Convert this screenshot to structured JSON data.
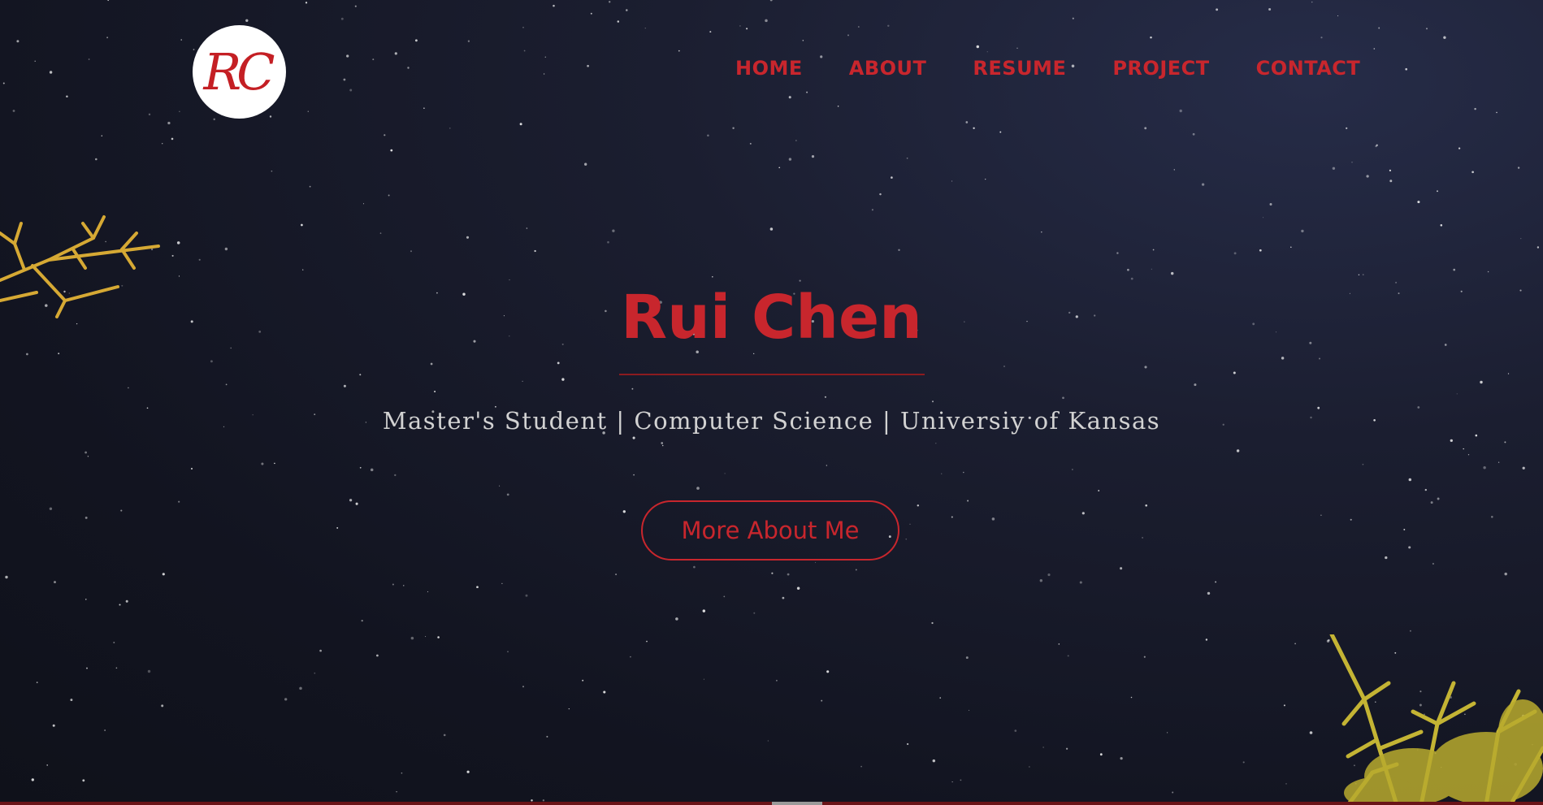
{
  "logo": {
    "text": "RC",
    "icon": "rc-monogram-logo"
  },
  "nav": {
    "items": [
      {
        "label": "HOME"
      },
      {
        "label": "ABOUT"
      },
      {
        "label": "RESUME"
      },
      {
        "label": "PROJECT"
      },
      {
        "label": "CONTACT"
      }
    ]
  },
  "hero": {
    "name": "Rui Chen",
    "subtitle": "Master's Student | Computer Science | Universiy of Kansas",
    "cta_label": "More About Me"
  },
  "colors": {
    "accent": "#c8262d",
    "background": "#121420",
    "subtitle_text": "#d2d2d2",
    "foliage": "#c9b73a"
  }
}
